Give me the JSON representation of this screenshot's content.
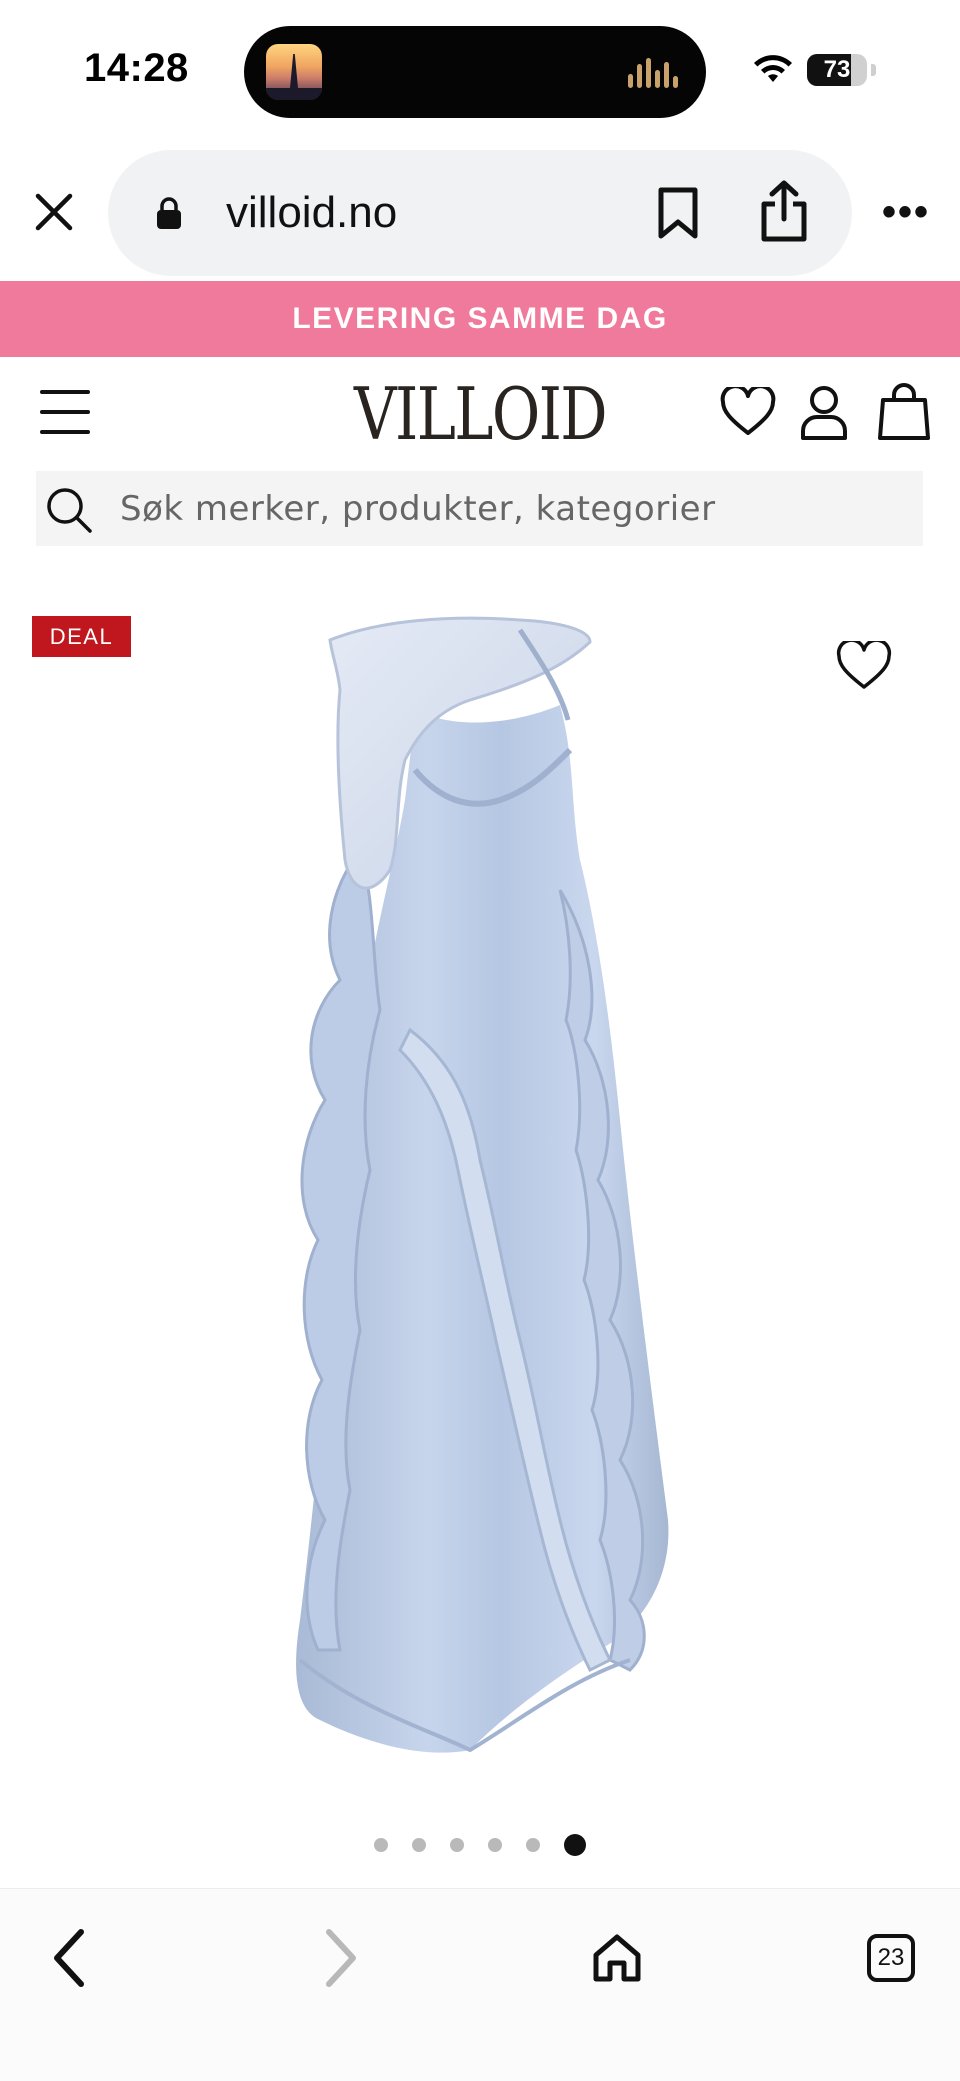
{
  "status_bar": {
    "time": "14:28",
    "battery_level": "73",
    "battery_fraction": 0.73,
    "icons": [
      "wifi-icon",
      "battery-icon"
    ]
  },
  "browser": {
    "url": "villoid.no",
    "icons": [
      "close-icon",
      "lock-icon",
      "bookmark-icon",
      "share-icon",
      "more-icon"
    ],
    "more_label": "•••"
  },
  "promo": {
    "text": "LEVERING SAMME DAG",
    "background": "#f07a9c"
  },
  "header": {
    "logo": "VILLOID",
    "icons": [
      "menu-icon",
      "heart-icon",
      "user-icon",
      "bag-icon"
    ]
  },
  "search": {
    "placeholder": "Søk merker, produkter, kategorier",
    "value": ""
  },
  "product": {
    "badge": "DEAL",
    "badge_color": "#c0161e",
    "image_subject": "light blue satin ruffled maxi dress",
    "image_count": 6,
    "active_image_index": 5
  },
  "bottom_toolbar": {
    "tabs_count": "23",
    "icons": [
      "back-icon",
      "forward-icon",
      "home-icon",
      "tabs-icon"
    ]
  }
}
